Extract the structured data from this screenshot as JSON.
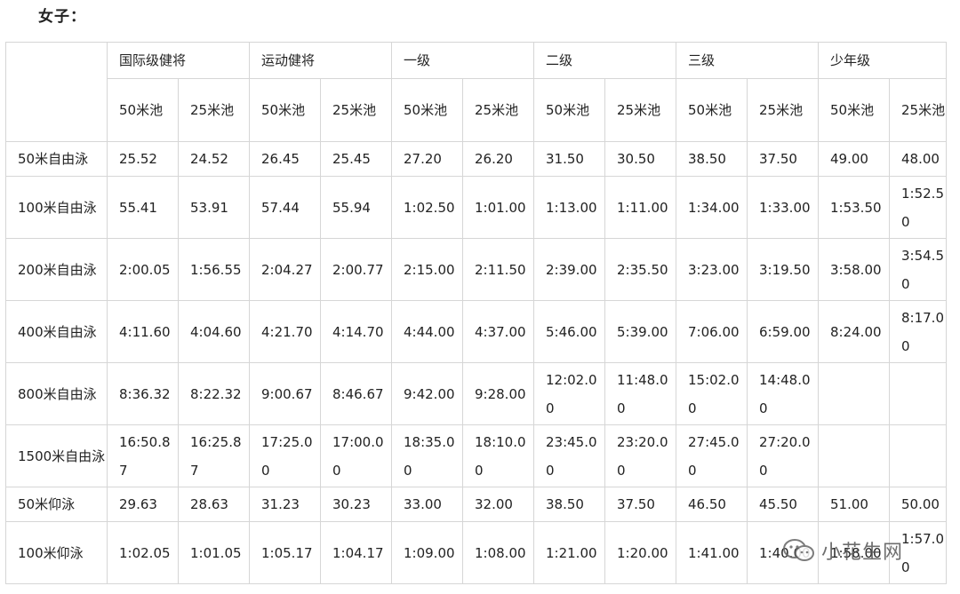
{
  "heading": "女子：",
  "groups": [
    "国际级健将",
    "运动健将",
    "一级",
    "二级",
    "三级",
    "少年级"
  ],
  "pools": [
    "50米池",
    "25米池"
  ],
  "rows": [
    {
      "event": "50米自由泳",
      "cells": [
        "25.52",
        "24.52",
        "26.45",
        "25.45",
        "27.20",
        "26.20",
        "31.50",
        "30.50",
        "38.50",
        "37.50",
        "49.00",
        "48.00"
      ]
    },
    {
      "event": "100米自由泳",
      "cells": [
        "55.41",
        "53.91",
        "57.44",
        "55.94",
        "1:02.50",
        "1:01.00",
        "1:13.00",
        "1:11.00",
        "1:34.00",
        "1:33.00",
        "1:53.50",
        "1:52.50"
      ]
    },
    {
      "event": "200米自由泳",
      "cells": [
        "2:00.05",
        "1:56.55",
        "2:04.27",
        "2:00.77",
        "2:15.00",
        "2:11.50",
        "2:39.00",
        "2:35.50",
        "3:23.00",
        "3:19.50",
        "3:58.00",
        "3:54.50"
      ]
    },
    {
      "event": "400米自由泳",
      "cells": [
        "4:11.60",
        "4:04.60",
        "4:21.70",
        "4:14.70",
        "4:44.00",
        "4:37.00",
        "5:46.00",
        "5:39.00",
        "7:06.00",
        "6:59.00",
        "8:24.00",
        "8:17.00"
      ]
    },
    {
      "event": "800米自由泳",
      "cells": [
        "8:36.32",
        "8:22.32",
        "9:00.67",
        "8:46.67",
        "9:42.00",
        "9:28.00",
        "12:02.00",
        "11:48.00",
        "15:02.00",
        "14:48.00",
        "",
        ""
      ]
    },
    {
      "event": "1500米自由泳",
      "cells": [
        "16:50.87",
        "16:25.87",
        "17:25.00",
        "17:00.00",
        "18:35.00",
        "18:10.00",
        "23:45.00",
        "23:20.00",
        "27:45.00",
        "27:20.00",
        "",
        ""
      ]
    },
    {
      "event": "50米仰泳",
      "cells": [
        "29.63",
        "28.63",
        "31.23",
        "30.23",
        "33.00",
        "32.00",
        "38.50",
        "37.50",
        "46.50",
        "45.50",
        "51.00",
        "50.00"
      ]
    },
    {
      "event": "100米仰泳",
      "cells": [
        "1:02.05",
        "1:01.05",
        "1:05.17",
        "1:04.17",
        "1:09.00",
        "1:08.00",
        "1:21.00",
        "1:20.00",
        "1:41.00",
        "1:40.00",
        "1:58.00",
        "1:57.00"
      ]
    }
  ],
  "watermark": "小花生网"
}
